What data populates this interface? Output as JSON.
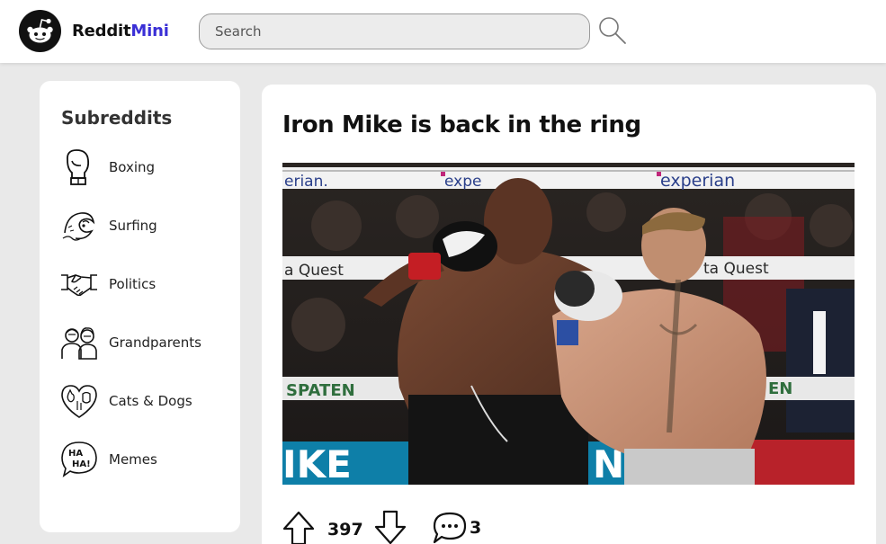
{
  "header": {
    "brand_prefix": "Reddit",
    "brand_suffix": "Mini",
    "search_placeholder": "Search"
  },
  "sidebar": {
    "title": "Subreddits",
    "items": [
      {
        "label": "Boxing",
        "icon": "boxing-glove-icon"
      },
      {
        "label": "Surfing",
        "icon": "wave-icon"
      },
      {
        "label": "Politics",
        "icon": "handshake-icon"
      },
      {
        "label": "Grandparents",
        "icon": "grandparents-icon"
      },
      {
        "label": "Cats & Dogs",
        "icon": "cat-dog-heart-icon"
      },
      {
        "label": "Memes",
        "icon": "haha-icon"
      }
    ]
  },
  "post": {
    "title": "Iron Mike is back in the ring",
    "upvotes": "397",
    "comments": "3",
    "image_text": {
      "rope_top_brand": "experian",
      "rope_top_brand_left": "erian.",
      "rope_top_brand_mid": "expe",
      "rope_mid_left": "a Quest",
      "rope_mid_right": "ta Quest",
      "rope_low_left": "SPATEN",
      "rope_low_right": "EN",
      "apron_text": "IKE",
      "apron_text_right": "N"
    }
  },
  "colors": {
    "brand_accent": "#3a2fd6",
    "background": "#e9e9e9",
    "card": "#ffffff"
  }
}
